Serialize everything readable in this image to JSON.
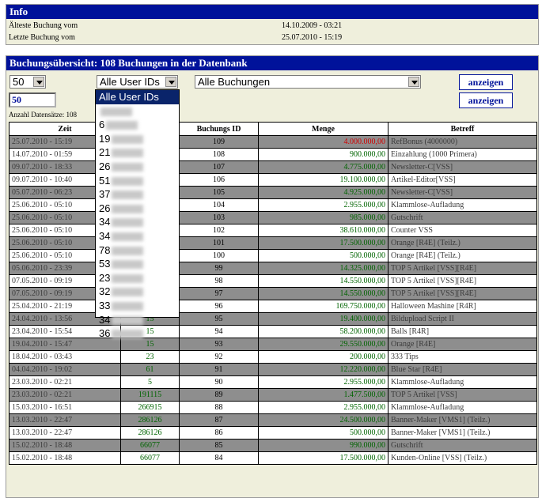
{
  "info": {
    "title": "Info",
    "rows": [
      {
        "label": "Älteste Buchung vom",
        "value": "14.10.2009 - 03:21"
      },
      {
        "label": "Letzte Buchung vom",
        "value": "25.07.2010 - 15:19"
      }
    ]
  },
  "overview": {
    "title": "Buchungsübersicht: 108 Buchungen in der Datenbank",
    "count_select": "50",
    "user_select": "Alle User IDs",
    "booking_select": "Alle Buchungen",
    "limit_input": "50",
    "show_button": "anzeigen",
    "show_button_2": "anzeigen",
    "record_count": "Anzahl Datensätze: 108"
  },
  "dropdown_options": [
    "Alle User IDs",
    "",
    "6",
    "19",
    "21",
    "26",
    "51",
    "37",
    "26",
    "34",
    "34",
    "78",
    "53",
    "23",
    "32",
    "33",
    "34",
    "36"
  ],
  "table": {
    "headers": [
      "Zeit",
      "",
      "Buchungs ID",
      "Menge",
      "Betreff"
    ],
    "rows": [
      {
        "zeit": "25.07.2010 - 15:19",
        "user": "",
        "id": "109",
        "menge": "4.000.000,00",
        "betreff": "RefBonus (4000000)",
        "shade": "g",
        "color": "red"
      },
      {
        "zeit": "14.07.2010 - 01:59",
        "user": "",
        "id": "108",
        "menge": "900.000,00",
        "betreff": "Einzahlung (1000 Primera)",
        "shade": "w",
        "color": "green"
      },
      {
        "zeit": "09.07.2010 - 18:33",
        "user": "",
        "id": "107",
        "menge": "4.775.000,00",
        "betreff": "Newsletter-C[VSS]",
        "shade": "g",
        "color": "green"
      },
      {
        "zeit": "09.07.2010 - 10:40",
        "user": "",
        "id": "106",
        "menge": "19.100.000,00",
        "betreff": "Artikel-Editor[VSS]",
        "shade": "w",
        "color": "green"
      },
      {
        "zeit": "05.07.2010 - 06:23",
        "user": "",
        "id": "105",
        "menge": "4.925.000,00",
        "betreff": "Newsletter-C[VSS]",
        "shade": "g",
        "color": "green"
      },
      {
        "zeit": "25.06.2010 - 05:10",
        "user": "",
        "id": "104",
        "menge": "2.955.000,00",
        "betreff": "Klammlose-Aufladung",
        "shade": "w",
        "color": "green"
      },
      {
        "zeit": "25.06.2010 - 05:10",
        "user": "",
        "id": "103",
        "menge": "985.000,00",
        "betreff": "Gutschrift",
        "shade": "g",
        "color": "green"
      },
      {
        "zeit": "25.06.2010 - 05:10",
        "user": "",
        "id": "102",
        "menge": "38.610.000,00",
        "betreff": "Counter VSS",
        "shade": "w",
        "color": "green"
      },
      {
        "zeit": "25.06.2010 - 05:10",
        "user": "",
        "id": "101",
        "menge": "17.500.000,00",
        "betreff": "Orange [R4E] (Teilz.)",
        "shade": "g",
        "color": "green"
      },
      {
        "zeit": "25.06.2010 - 05:10",
        "user": "",
        "id": "100",
        "menge": "500.000,00",
        "betreff": "Orange [R4E] (Teilz.)",
        "shade": "w",
        "color": "green"
      },
      {
        "zeit": "05.06.2010 - 23:39",
        "user": "",
        "id": "99",
        "menge": "14.325.000,00",
        "betreff": "TOP 5 Artikel [VSS][R4E]",
        "shade": "g",
        "color": "green"
      },
      {
        "zeit": "07.05.2010 - 09:19",
        "user": "",
        "id": "98",
        "menge": "14.550.000,00",
        "betreff": "TOP 5 Artikel [VSS][R4E]",
        "shade": "w",
        "color": "green"
      },
      {
        "zeit": "07.05.2010 - 09:19",
        "user": "",
        "id": "97",
        "menge": "14.550.000,00",
        "betreff": "TOP 5 Artikel [VSS][R4E]",
        "shade": "g",
        "color": "green"
      },
      {
        "zeit": "25.04.2010 - 21:19",
        "user": "",
        "id": "96",
        "menge": "169.750.000,00",
        "betreff": "Halloween Mashine [R4R]",
        "shade": "w",
        "color": "green"
      },
      {
        "zeit": "24.04.2010 - 13:56",
        "user": "15",
        "id": "95",
        "menge": "19.400.000,00",
        "betreff": "Bildupload Script II",
        "shade": "g",
        "color": "green"
      },
      {
        "zeit": "23.04.2010 - 15:54",
        "user": "15",
        "id": "94",
        "menge": "58.200.000,00",
        "betreff": "Balls [R4R]",
        "shade": "w",
        "color": "green"
      },
      {
        "zeit": "19.04.2010 - 15:47",
        "user": "15",
        "id": "93",
        "menge": "29.550.000,00",
        "betreff": "Orange [R4E]",
        "shade": "g",
        "color": "green"
      },
      {
        "zeit": "18.04.2010 - 03:43",
        "user": "23",
        "id": "92",
        "menge": "200.000,00",
        "betreff": "333 Tips",
        "shade": "w",
        "color": "green"
      },
      {
        "zeit": "04.04.2010 - 19:02",
        "user": "61",
        "id": "91",
        "menge": "12.220.000,00",
        "betreff": "Blue Star [R4E]",
        "shade": "g",
        "color": "green"
      },
      {
        "zeit": "23.03.2010 - 02:21",
        "user": "5",
        "id": "90",
        "menge": "2.955.000,00",
        "betreff": "Klammlose-Aufladung",
        "shade": "w",
        "color": "green"
      },
      {
        "zeit": "23.03.2010 - 02:21",
        "user": "191115",
        "id": "89",
        "menge": "1.477.500,00",
        "betreff": "TOP 5 Artikel [VSS]",
        "shade": "g",
        "color": "green"
      },
      {
        "zeit": "15.03.2010 - 16:51",
        "user": "266915",
        "id": "88",
        "menge": "2.955.000,00",
        "betreff": "Klammlose-Aufladung",
        "shade": "w",
        "color": "green"
      },
      {
        "zeit": "13.03.2010 - 22:47",
        "user": "286126",
        "id": "87",
        "menge": "24.500.000,00",
        "betreff": "Banner-Maker [VMS1] (Teilz.)",
        "shade": "g",
        "color": "green"
      },
      {
        "zeit": "13.03.2010 - 22:47",
        "user": "286126",
        "id": "86",
        "menge": "500.000,00",
        "betreff": "Banner-Maker [VMS1] (Teilz.)",
        "shade": "w",
        "color": "green"
      },
      {
        "zeit": "15.02.2010 - 18:48",
        "user": "66077",
        "id": "85",
        "menge": "990.000,00",
        "betreff": "Gutschrift",
        "shade": "g",
        "color": "green"
      },
      {
        "zeit": "15.02.2010 - 18:48",
        "user": "66077",
        "id": "84",
        "menge": "17.500.000,00",
        "betreff": "Kunden-Online [VSS] (Teilz.)",
        "shade": "w",
        "color": "green"
      }
    ]
  },
  "colors": {
    "header_bg": "#00129a",
    "panel_bg": "#efefdc",
    "row_gray": "#8e8e8e",
    "amount_green": "#006400",
    "amount_red": "#d00000",
    "selected_option": "#0a246a"
  }
}
